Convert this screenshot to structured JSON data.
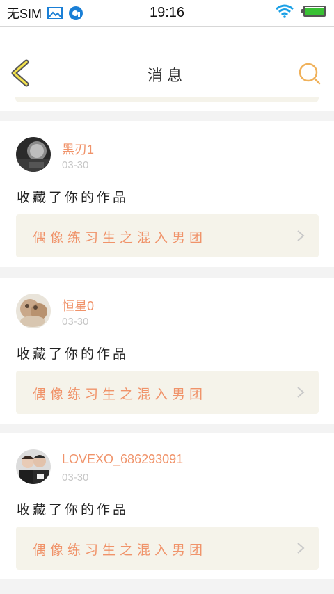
{
  "status_bar": {
    "carrier": "无SIM",
    "time": "19:16",
    "battery_level": 0.95,
    "battery_color": "#39c134"
  },
  "header": {
    "title": "消息",
    "back_icon": "chevron-left-icon",
    "search_icon": "search-icon",
    "accent_color": "#f0b15a"
  },
  "messages": [
    {
      "username": "黑刃1",
      "date": "03-30",
      "action": "收藏了你的作品",
      "work_title": "偶像练习生之混入男团"
    },
    {
      "username": "恒星0",
      "date": "03-30",
      "action": "收藏了你的作品",
      "work_title": "偶像练习生之混入男团"
    },
    {
      "username": "LOVEXO_686293091",
      "date": "03-30",
      "action": "收藏了你的作品",
      "work_title": "偶像练习生之混入男团"
    }
  ],
  "colors": {
    "username": "#f0936a",
    "card_link_bg": "#f5f3ea",
    "page_bg": "#f3f3f3"
  }
}
